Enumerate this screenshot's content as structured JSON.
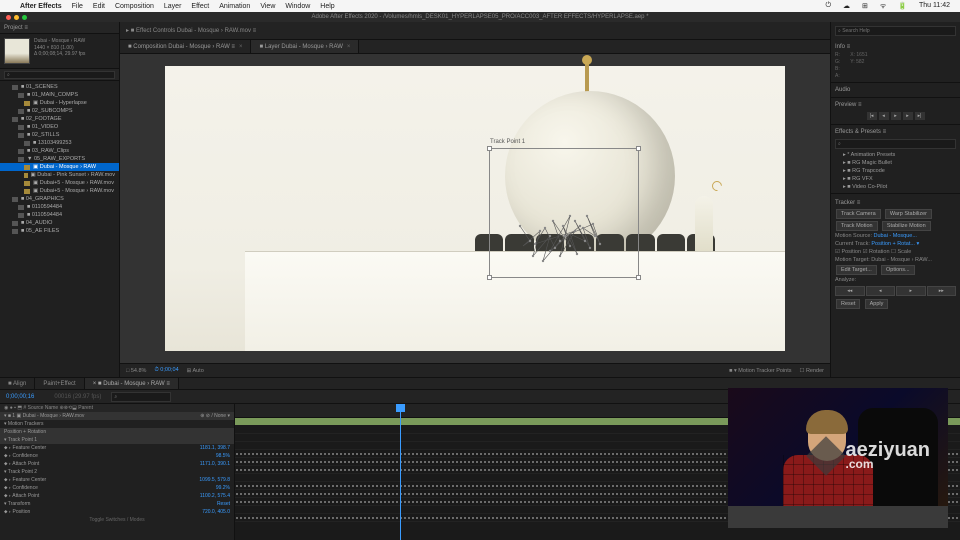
{
  "mac": {
    "app": "After Effects",
    "menus": [
      "File",
      "Edit",
      "Composition",
      "Layer",
      "Effect",
      "Animation",
      "View",
      "Window",
      "Help"
    ],
    "right": [
      "⏻",
      "☁",
      "⊞",
      "ᯤ",
      "🔋",
      "Thu 11:42"
    ]
  },
  "titlebar": "Adobe After Effects 2020 - /Volumes/hmls_DESK01_HYPERLAPSE05_PRO/ACC003_AFTER EFFECTS/HYPERLAPSE.aep *",
  "project": {
    "title": "Project ≡",
    "thumb_name": "Dubai - Mosque › RAW",
    "thumb_info": "1440 × 810 (1.00)\nΔ 0;00;08;14, 29.97 fps",
    "search_ph": "⌕",
    "items": [
      {
        "d": 0,
        "ico": "f",
        "name": "■ 01_SCENES"
      },
      {
        "d": 1,
        "ico": "f",
        "name": "■ 01_MAIN_COMPS"
      },
      {
        "d": 2,
        "ico": "c",
        "name": "▣ Dubai - Hyperlapse"
      },
      {
        "d": 1,
        "ico": "f",
        "name": "■ 02_SUBCOMPS"
      },
      {
        "d": 0,
        "ico": "f",
        "name": "■ 02_FOOTAGE"
      },
      {
        "d": 1,
        "ico": "f",
        "name": "■ 01_VIDEO"
      },
      {
        "d": 1,
        "ico": "f",
        "name": "■ 02_STILLS"
      },
      {
        "d": 2,
        "ico": "f",
        "name": "■ 13103499253"
      },
      {
        "d": 1,
        "ico": "f",
        "name": "■ 03_RAW_Clips"
      },
      {
        "d": 1,
        "ico": "f",
        "name": "▼ 05_RAW_EXPORTS"
      },
      {
        "d": 2,
        "ico": "c",
        "name": "▣ Dubai - Mosque › RAW",
        "sel": true
      },
      {
        "d": 2,
        "ico": "c",
        "name": "▣ Dubai - Pink Sunset › RAW.mov"
      },
      {
        "d": 2,
        "ico": "c",
        "name": "▣ Dubai+5 - Mosque › RAW.mov"
      },
      {
        "d": 2,
        "ico": "c",
        "name": "▣ Dubai+5 - Mosque › RAW.mov"
      },
      {
        "d": 0,
        "ico": "f",
        "name": "■ 04_GRAPHICS"
      },
      {
        "d": 1,
        "ico": "f",
        "name": "■ 0110594484"
      },
      {
        "d": 1,
        "ico": "f",
        "name": "■ 0110594484"
      },
      {
        "d": 0,
        "ico": "f",
        "name": "■ 04_AUDIO"
      },
      {
        "d": 0,
        "ico": "f",
        "name": "■ 05_AE FILES"
      }
    ]
  },
  "fx_strip": "▸ ■ Effect Controls Dubai - Mosque › RAW.mov ≡",
  "viewer": {
    "tabs": [
      {
        "label": "■ Composition Dubai - Mosque › RAW ≡",
        "active": false
      },
      {
        "label": "■ Layer Dubai - Mosque › RAW",
        "active": true
      }
    ],
    "track_label": "Track Point 1",
    "controls": {
      "zoom": "□ 54.8%",
      "time": "⏱ 0;00;04",
      "res": "⊞ Auto",
      "view": "■ ▾ Motion Tracker Points",
      "render": "☐ Render"
    }
  },
  "right": {
    "info_head": "Info ≡",
    "info": {
      "x": "X: 1651",
      "y": "Y: 582",
      "r": "R:",
      "g": "G:",
      "b": "B:",
      "a": "A:"
    },
    "audio_head": "Audio",
    "preview_head": "Preview ≡",
    "fx_head": "Effects & Presets ≡",
    "fx_search": "⌕",
    "fx_search_ph": "",
    "fx_items": [
      "▸ * Animation Presets",
      "▸ ■ RG Magic Bullet",
      "▸ ■ RG Trapcode",
      "▸ ■ RG VFX",
      "▸ ■ Video Co-Pilot"
    ],
    "tracker_head": "Tracker ≡",
    "tracker": {
      "btns1": [
        "Track Camera",
        "Warp Stabilizer"
      ],
      "btns2": [
        "Track Motion",
        "Stabilize Motion"
      ],
      "source_lbl": "Motion Source:",
      "source_val": "Dubai - Mosque...",
      "track_lbl": "Current Track:",
      "track_val": "Position + Rotat... ▾",
      "cb": [
        "☑ Position",
        "☑ Rotation",
        "☐ Scale"
      ],
      "target_lbl": "Motion Target: Dubai - Mosque › RAW...",
      "btns3": [
        "Edit Target...",
        "Options..."
      ],
      "analyze_lbl": "Analyze:",
      "analyze": [
        "◂◂",
        "◂",
        "▸",
        "▸▸"
      ],
      "btns4": [
        "Reset",
        "Apply"
      ]
    },
    "help_ph": "⌕ Search Help"
  },
  "timeline": {
    "tabs": [
      {
        "label": "■ Align",
        "active": false
      },
      {
        "label": "Paint+Effect",
        "active": false
      },
      {
        "label": "× ■ Dubai - Mosque › RAW ≡",
        "active": true
      }
    ],
    "timecode": "0;00;00;16",
    "tc_sub": "00016 (29.97 fps)",
    "search": "⌕",
    "cols": "◉ ● ▪ ⬒  #  Source Name           ⊕⊗⟲⬓  Parent",
    "layers": [
      {
        "name": "▾ ■ 1  ▣ Dubai - Mosque › RAW.mov",
        "sel": true,
        "ctrl": "⊕ ⊘ /  None ▾"
      },
      {
        "name": "  ▾ Motion Trackers"
      },
      {
        "name": "    Position + Rotation",
        "sel": true
      },
      {
        "name": "    ▾ Track Point 1",
        "sel": true
      },
      {
        "name": "      ⬥ ▹ Feature Center",
        "val": "1181.1, 398.7"
      },
      {
        "name": "      ⬥ ▹ Confidence",
        "val": "98.5%"
      },
      {
        "name": "      ⬥ ▹ Attach Point",
        "val": "1171.0, 390.1"
      },
      {
        "name": "    ▾ Track Point 2"
      },
      {
        "name": "      ⬥ ▹ Feature Center",
        "val": "1099.5, 579.8"
      },
      {
        "name": "      ⬥ ▹ Confidence",
        "val": "99.2%"
      },
      {
        "name": "      ⬥ ▹ Attach Point",
        "val": "1100.2, 575.4"
      },
      {
        "name": "  ▾ Transform",
        "val": "Reset"
      },
      {
        "name": "      ⬥ ▹ Position",
        "val": "720.0, 405.0"
      }
    ],
    "footer": "Toggle Switches / Modes"
  },
  "watermark": {
    "main": "aeziyuan",
    "sub": ".com"
  }
}
